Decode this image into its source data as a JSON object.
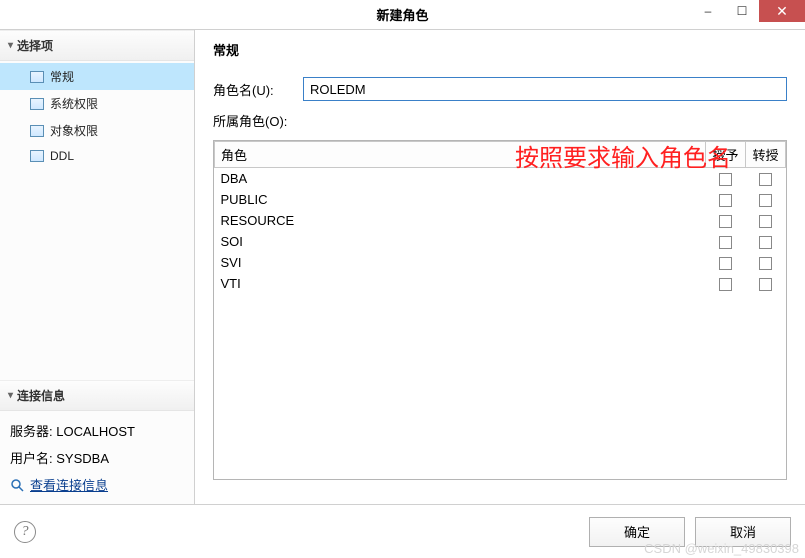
{
  "window": {
    "title": "新建角色",
    "minimize": "–",
    "maximize": "☐",
    "close": "✕"
  },
  "sidebar": {
    "options_header": "选择项",
    "items": [
      {
        "label": "常规",
        "selected": true
      },
      {
        "label": "系统权限",
        "selected": false
      },
      {
        "label": "对象权限",
        "selected": false
      },
      {
        "label": "DDL",
        "selected": false
      }
    ],
    "connection_header": "连接信息",
    "server_label": "服务器:",
    "server_value": "LOCALHOST",
    "user_label": "用户名:",
    "user_value": "SYSDBA",
    "view_link": "查看连接信息"
  },
  "main": {
    "panel_title": "常规",
    "role_name_label": "角色名(U):",
    "role_name_value": "ROLEDM",
    "belong_role_label": "所属角色(O):",
    "table": {
      "col_role": "角色",
      "col_grant": "授予",
      "col_transfer": "转授",
      "rows": [
        {
          "name": "DBA"
        },
        {
          "name": "PUBLIC"
        },
        {
          "name": "RESOURCE"
        },
        {
          "name": "SOI"
        },
        {
          "name": "SVI"
        },
        {
          "name": "VTI"
        }
      ]
    }
  },
  "annotation": "按照要求输入角色名",
  "footer": {
    "help": "?",
    "ok": "确定",
    "cancel": "取消"
  },
  "watermark": "CSDN @weixin_49830398"
}
